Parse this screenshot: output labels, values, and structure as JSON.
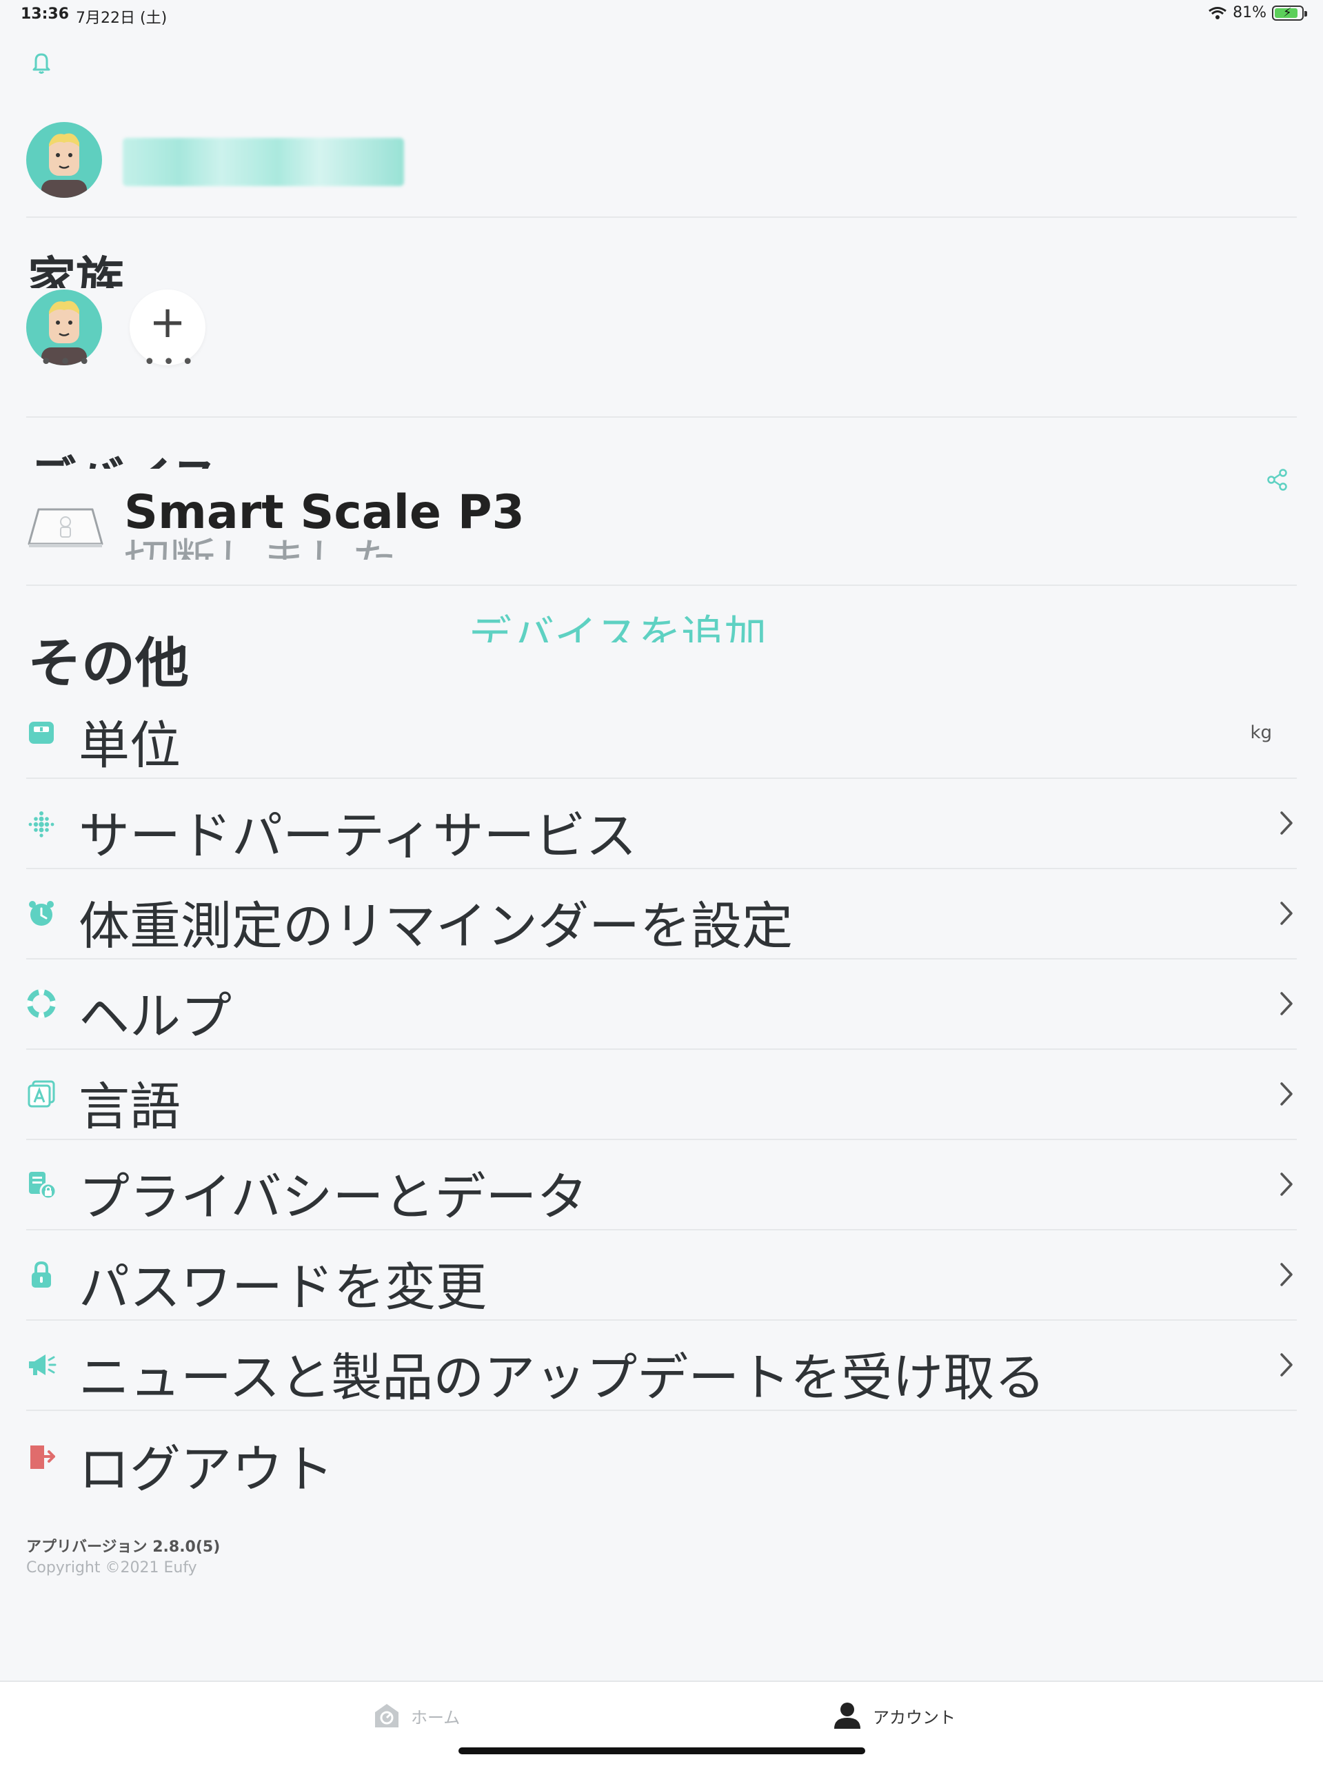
{
  "status": {
    "time": "13:36",
    "date": "7月22日 (土)",
    "battery": "81%"
  },
  "profile": {
    "avatar": "avatar"
  },
  "family": {
    "title": "家族",
    "add_label": "+",
    "dots": "•••"
  },
  "devices": {
    "title": "デバイス",
    "items": [
      {
        "name": "Smart Scale P3",
        "status": "切断しました"
      }
    ],
    "add_label": "デバイスを追加"
  },
  "other": {
    "title": "その他",
    "items": [
      {
        "label": "単位",
        "value": "kg",
        "icon": "unit-icon",
        "color": "#5ed1c2"
      },
      {
        "label": "サードパーティサービス",
        "icon": "fitbit-icon",
        "color": "#5ed1c2"
      },
      {
        "label": "体重測定のリマインダーを設定",
        "icon": "alarm-clock-icon",
        "color": "#5ed1c2"
      },
      {
        "label": "ヘルプ",
        "icon": "lifebuoy-icon",
        "color": "#5ed1c2"
      },
      {
        "label": "言語",
        "icon": "language-icon",
        "color": "#5ed1c2"
      },
      {
        "label": "プライバシーとデータ",
        "icon": "privacy-icon",
        "color": "#5ed1c2"
      },
      {
        "label": "パスワードを変更",
        "icon": "lock-icon",
        "color": "#5ed1c2"
      },
      {
        "label": "ニュースと製品のアップデートを受け取る",
        "icon": "megaphone-icon",
        "color": "#5ed1c2"
      }
    ],
    "logout_label": "ログアウト",
    "logout_color": "#e06c6c"
  },
  "footer": {
    "version": "アプリバージョン 2.8.0(5)",
    "copyright": "Copyright ©2021 Eufy"
  },
  "tabs": {
    "home": "ホーム",
    "account": "アカウント"
  },
  "colors": {
    "accent": "#5ed1c2",
    "background": "#f6f7f9"
  }
}
